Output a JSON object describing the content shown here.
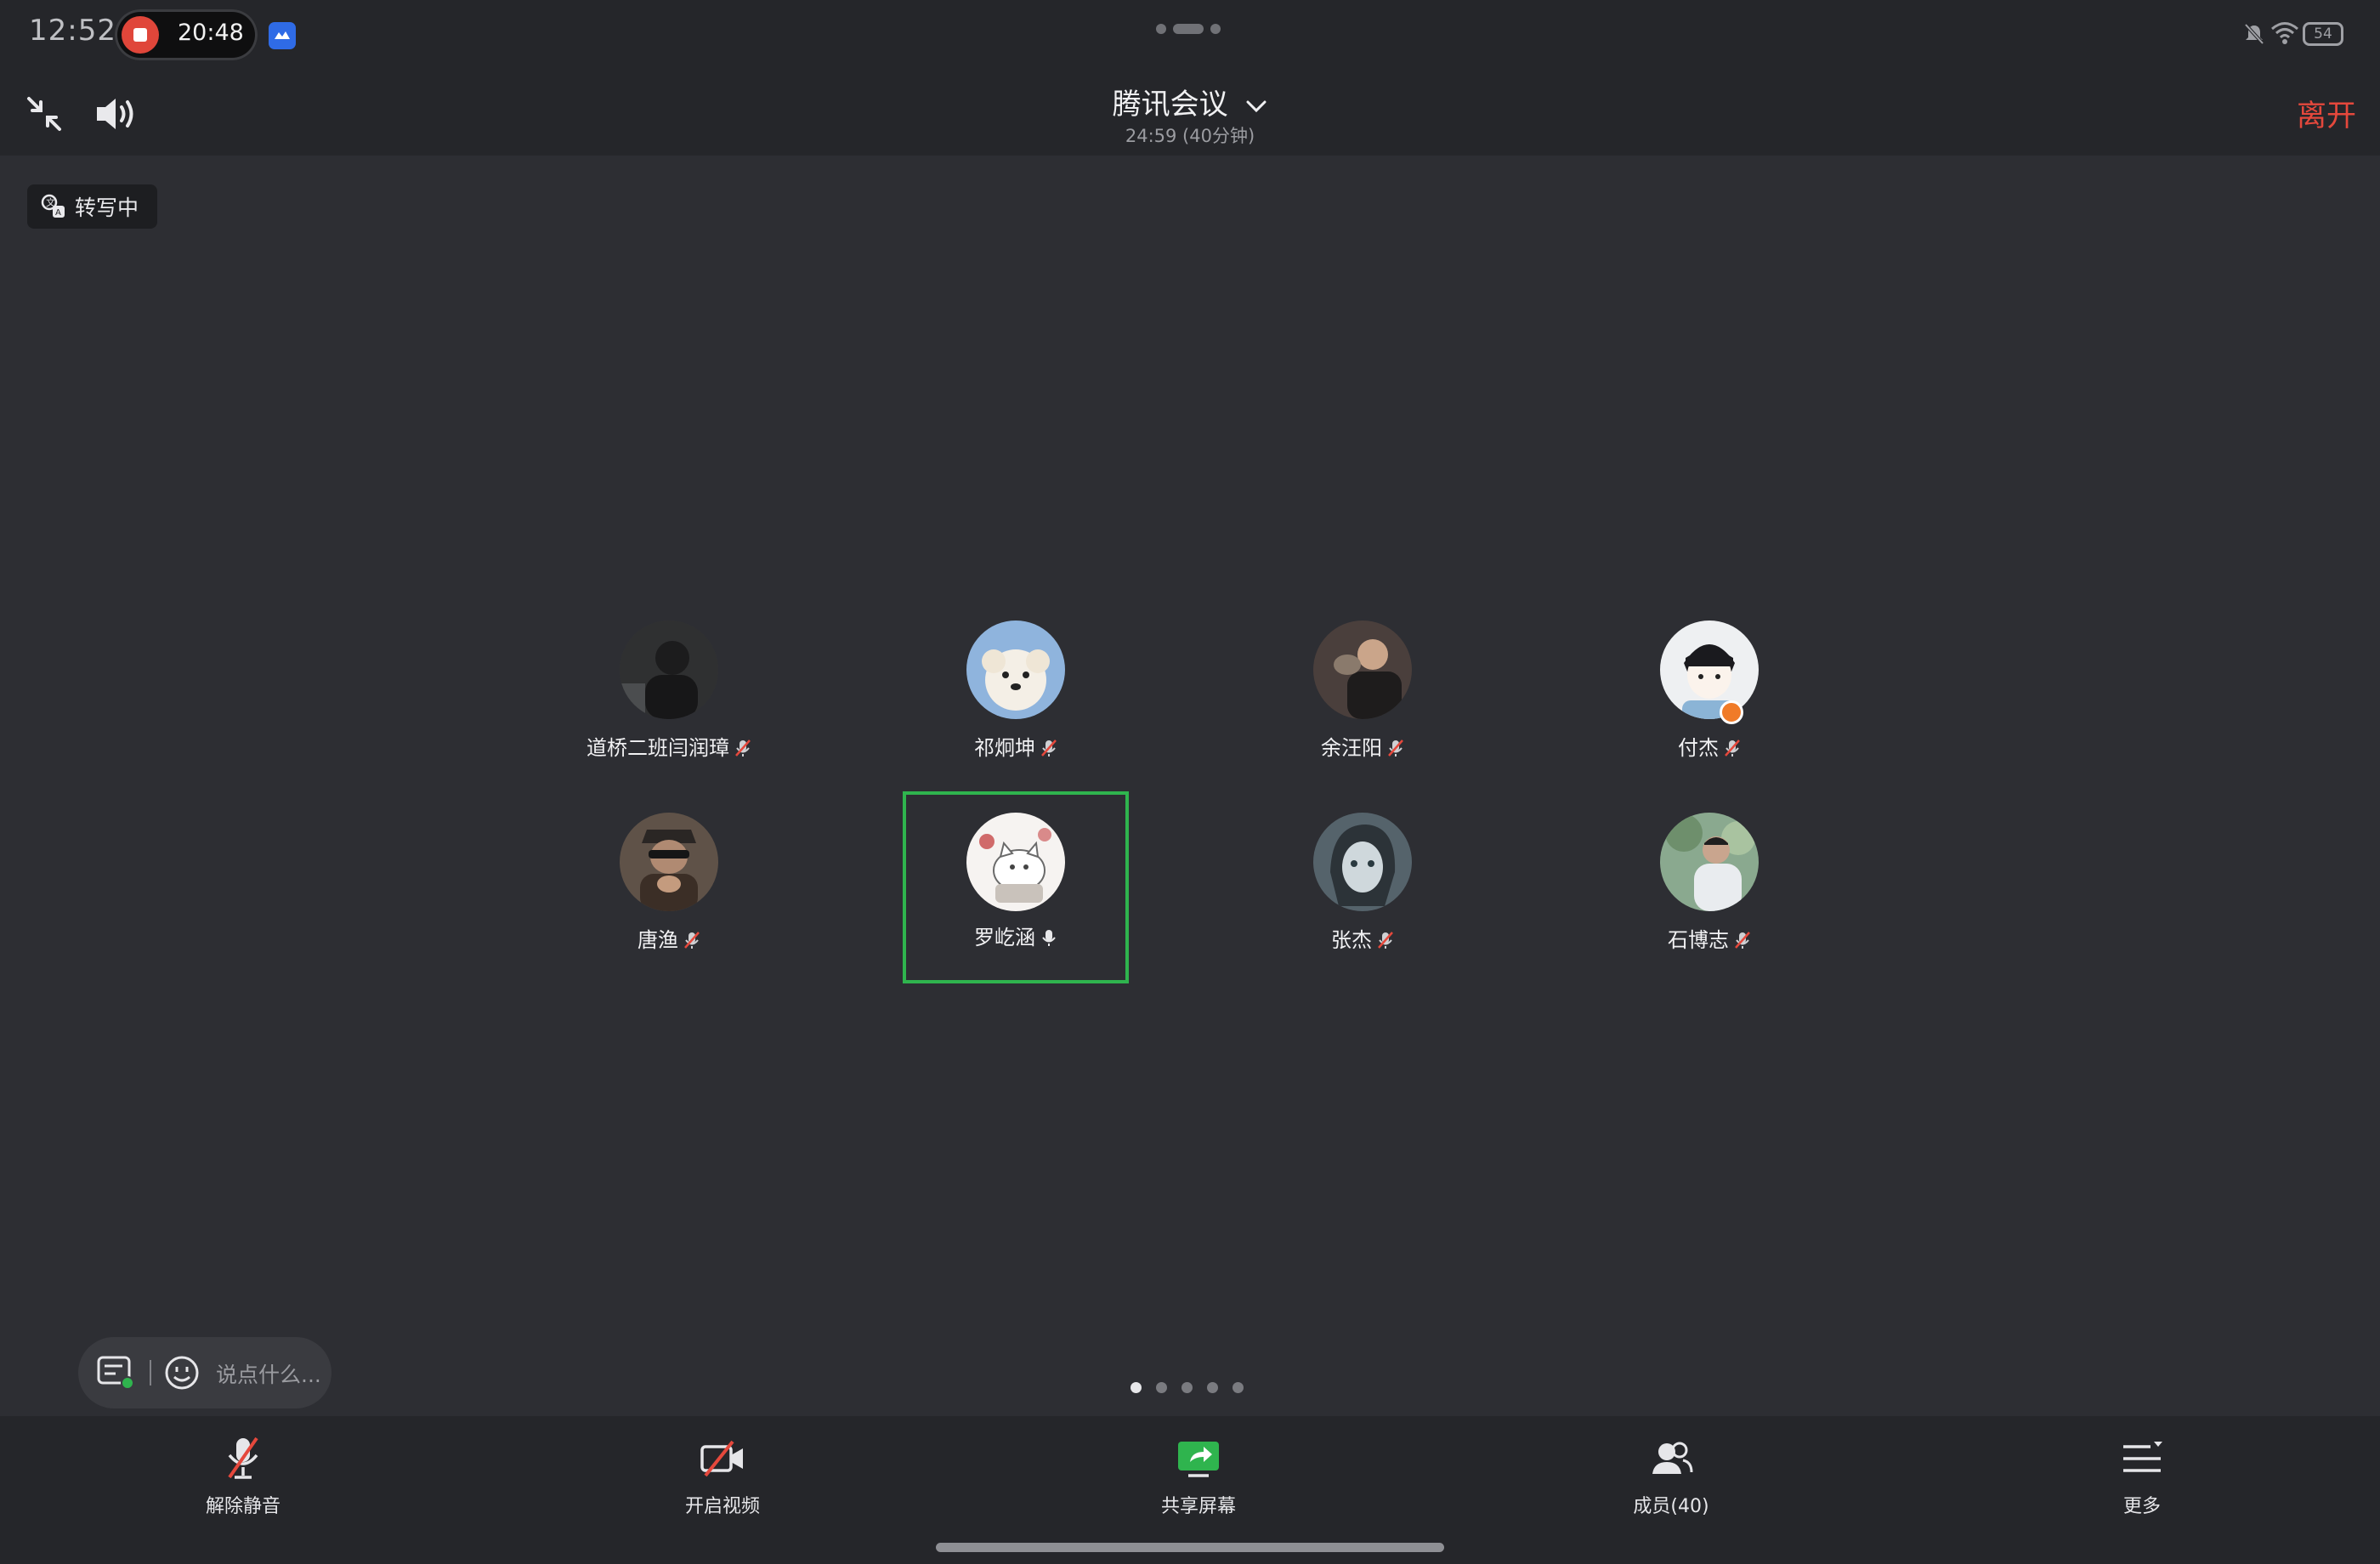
{
  "status_bar": {
    "clock": "12:52",
    "recording_time": "20:48",
    "battery": "54"
  },
  "header": {
    "title": "腾讯会议",
    "subtitle": "24:59 (40分钟)",
    "leave_label": "离开"
  },
  "transcription": {
    "label": "转写中"
  },
  "participants": [
    {
      "name": "道桥二班闫润璋",
      "mic": "muted",
      "avatar_color": "#3a3a3c"
    },
    {
      "name": "祁炯坤",
      "mic": "muted",
      "avatar_color": "#8fb4dd"
    },
    {
      "name": "余汪阳",
      "mic": "muted",
      "avatar_color": "#5a4a46"
    },
    {
      "name": "付杰",
      "mic": "muted",
      "avatar_color": "#e9ecef",
      "host": true
    },
    {
      "name": "唐渔",
      "mic": "muted",
      "avatar_color": "#6b5a48"
    },
    {
      "name": "罗屹涵",
      "mic": "on",
      "avatar_color": "#f3f0ee",
      "active": true
    },
    {
      "name": "张杰",
      "mic": "muted",
      "avatar_color": "#5d6b74"
    },
    {
      "name": "石博志",
      "mic": "muted",
      "avatar_color": "#7f9f8a"
    }
  ],
  "chat": {
    "placeholder": "说点什么..."
  },
  "pagination": {
    "total": 5,
    "current": 1
  },
  "toolbar": {
    "unmute": "解除静音",
    "video": "开启视频",
    "share": "共享屏幕",
    "members": "成员(40)",
    "more": "更多"
  },
  "colors": {
    "background": "#2d2e33",
    "bar": "#25262a",
    "leave": "#e5483c",
    "active_outline": "#2fb44e",
    "share_icon": "#2fb44e"
  }
}
